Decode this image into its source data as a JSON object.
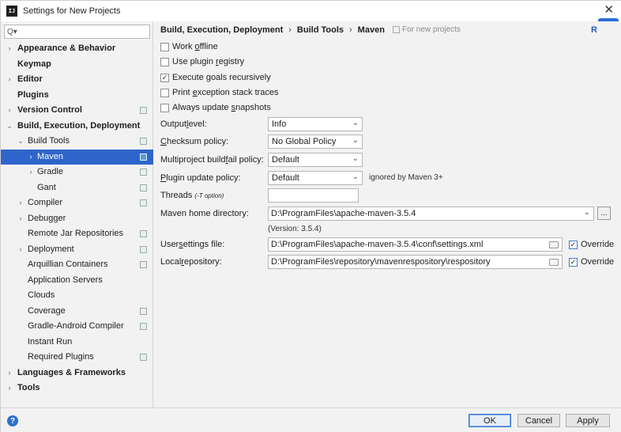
{
  "window": {
    "title": "Settings for New Projects",
    "app_icon": "IJ"
  },
  "search": {
    "placeholder": "Q▾",
    "value": ""
  },
  "tree": [
    {
      "label": "Appearance & Behavior",
      "bold": true,
      "arrow": "›",
      "indent": 0
    },
    {
      "label": "Keymap",
      "bold": true,
      "arrow": "",
      "indent": 0
    },
    {
      "label": "Editor",
      "bold": true,
      "arrow": "›",
      "indent": 0
    },
    {
      "label": "Plugins",
      "bold": true,
      "arrow": "",
      "indent": 0
    },
    {
      "label": "Version Control",
      "bold": true,
      "arrow": "›",
      "indent": 0,
      "project_icon": true
    },
    {
      "label": "Build, Execution, Deployment",
      "bold": true,
      "arrow": "⌄",
      "indent": 0
    },
    {
      "label": "Build Tools",
      "bold": false,
      "arrow": "⌄",
      "indent": 1,
      "project_icon": true
    },
    {
      "label": "Maven",
      "bold": false,
      "arrow": "›",
      "indent": 2,
      "project_icon": true,
      "selected": true
    },
    {
      "label": "Gradle",
      "bold": false,
      "arrow": "›",
      "indent": 2,
      "project_icon": true
    },
    {
      "label": "Gant",
      "bold": false,
      "arrow": "",
      "indent": 2,
      "project_icon": true
    },
    {
      "label": "Compiler",
      "bold": false,
      "arrow": "›",
      "indent": 1,
      "project_icon": true
    },
    {
      "label": "Debugger",
      "bold": false,
      "arrow": "›",
      "indent": 1
    },
    {
      "label": "Remote Jar Repositories",
      "bold": false,
      "arrow": "",
      "indent": 1,
      "project_icon": true
    },
    {
      "label": "Deployment",
      "bold": false,
      "arrow": "›",
      "indent": 1,
      "project_icon": true
    },
    {
      "label": "Arquillian Containers",
      "bold": false,
      "arrow": "",
      "indent": 1,
      "project_icon": true
    },
    {
      "label": "Application Servers",
      "bold": false,
      "arrow": "",
      "indent": 1
    },
    {
      "label": "Clouds",
      "bold": false,
      "arrow": "",
      "indent": 1
    },
    {
      "label": "Coverage",
      "bold": false,
      "arrow": "",
      "indent": 1,
      "project_icon": true
    },
    {
      "label": "Gradle-Android Compiler",
      "bold": false,
      "arrow": "",
      "indent": 1,
      "project_icon": true
    },
    {
      "label": "Instant Run",
      "bold": false,
      "arrow": "",
      "indent": 1
    },
    {
      "label": "Required Plugins",
      "bold": false,
      "arrow": "",
      "indent": 1,
      "project_icon": true
    },
    {
      "label": "Languages & Frameworks",
      "bold": true,
      "arrow": "›",
      "indent": 0
    },
    {
      "label": "Tools",
      "bold": true,
      "arrow": "›",
      "indent": 0
    }
  ],
  "breadcrumb": {
    "items": [
      "Build, Execution, Deployment",
      "Build Tools",
      "Maven"
    ],
    "separator": "›",
    "for_new_projects": "For new projects",
    "reset": "R"
  },
  "checkboxes": {
    "work_offline": {
      "label_pre": "Work ",
      "label_u": "o",
      "label_post": "ffline",
      "checked": false
    },
    "plugin_registry": {
      "label_pre": "Use plugin ",
      "label_u": "r",
      "label_post": "egistry",
      "checked": false
    },
    "execute_goals": {
      "label_pre": "Execute ",
      "label_u": "g",
      "label_post": "oals recursively",
      "checked": true
    },
    "print_exception": {
      "label_pre": "Print ",
      "label_u": "e",
      "label_post": "xception stack traces",
      "checked": false
    },
    "always_update": {
      "label_pre": "Always update ",
      "label_u": "s",
      "label_post": "napshots",
      "checked": false
    }
  },
  "form": {
    "output_level": {
      "label_pre": "Output ",
      "label_u": "l",
      "label_post": "evel:",
      "value": "Info"
    },
    "checksum_policy": {
      "label_pre": "",
      "label_u": "C",
      "label_post": "hecksum policy:",
      "value": "No Global Policy"
    },
    "multiproject": {
      "label_pre": "Multiproject build ",
      "label_u": "f",
      "label_post": "ail policy:",
      "value": "Default"
    },
    "plugin_update": {
      "label_pre": "",
      "label_u": "P",
      "label_post": "lugin update policy:",
      "value": "Default",
      "note": "ignored by Maven 3+"
    },
    "threads": {
      "label": "Threads",
      "hint": "(-T option)",
      "value": ""
    },
    "maven_home": {
      "label": "Maven home directory:",
      "value": "D:\\ProgramFiles\\apache-maven-3.5.4",
      "version": "(Version: 3.5.4)",
      "browse": "..."
    },
    "user_settings": {
      "label_pre": "User ",
      "label_u": "s",
      "label_post": "ettings file:",
      "value": "D:\\ProgramFiles\\apache-maven-3.5.4\\conf\\settings.xml",
      "override_label": "Override",
      "override_checked": true
    },
    "local_repo": {
      "label_pre": "Local ",
      "label_u": "r",
      "label_post": "epository:",
      "value": "D:\\ProgramFiles\\repository\\mavenrespository\\respository",
      "override_label": "Override",
      "override_checked": true
    }
  },
  "footer": {
    "help": "?",
    "ok": "OK",
    "cancel": "Cancel",
    "apply": "Apply"
  },
  "colors": {
    "selection": "#2f65ca",
    "accent": "#2a6fd6",
    "background": "#f2f2f2"
  },
  "icons": {
    "checkmark": "✓",
    "chevron": "⌄",
    "close": "✕"
  }
}
